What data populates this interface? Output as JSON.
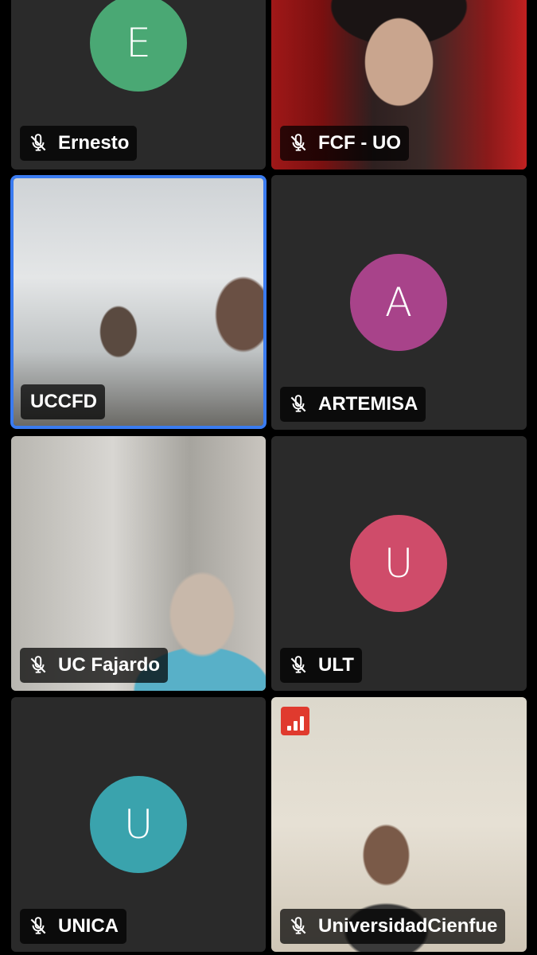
{
  "participants": [
    {
      "name": "Ernesto",
      "initial": "E",
      "avatar_color": "#4aa874",
      "muted": true
    },
    {
      "name": "FCF - UO",
      "initial": "",
      "video": true,
      "muted": true
    },
    {
      "name": "UCCFD",
      "initial": "",
      "video": true,
      "muted": false,
      "active_speaker": true
    },
    {
      "name": "ARTEMISA",
      "initial": "A",
      "avatar_color": "#a8438a",
      "muted": true
    },
    {
      "name": "UC Fajardo",
      "initial": "",
      "video": true,
      "muted": true
    },
    {
      "name": "ULT",
      "initial": "U",
      "avatar_color": "#cf4c6a",
      "muted": true
    },
    {
      "name": "UNICA",
      "initial": "U",
      "avatar_color": "#3aa3ad",
      "muted": true
    },
    {
      "name": "UniversidadCienfue",
      "initial": "",
      "video": true,
      "muted": true,
      "network_stats_icon": "signal-stats-icon"
    }
  ],
  "colors": {
    "tile_bg": "#2a2a2a",
    "active_border": "#3a7bf0",
    "stats_badge": "#e03a2e"
  }
}
